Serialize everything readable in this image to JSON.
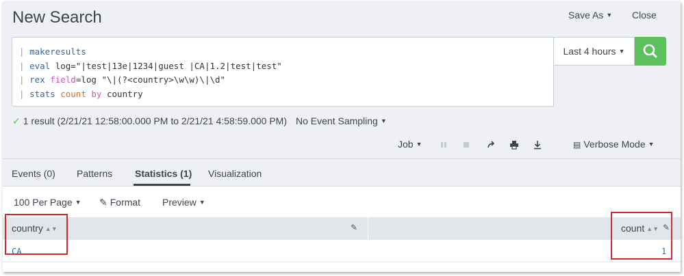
{
  "header": {
    "title": "New Search",
    "save_as_label": "Save As",
    "close_label": "Close"
  },
  "query": {
    "lines": [
      {
        "pipe": "|",
        "cmd": "makeresults"
      },
      {
        "pipe": "|",
        "cmd": "eval",
        "rest": " log=\"|test|13e|1234|guest |CA|1.2|test|test\""
      },
      {
        "pipe": "|",
        "cmd": "rex",
        "kw": "field",
        "rest": "=log \"\\|(?<country>\\w\\w)\\|\\d\""
      },
      {
        "pipe": "|",
        "cmd": "stats",
        "fn": "count",
        "kw2": "by",
        "rest": " country"
      }
    ]
  },
  "time_picker": {
    "label": "Last 4 hours"
  },
  "status": {
    "result_text": "1 result (2/21/21 12:58:00.000 PM to 2/21/21 4:58:59.000 PM)",
    "sampling_label": "No Event Sampling"
  },
  "job": {
    "job_label": "Job",
    "mode_label": "Verbose Mode"
  },
  "tabs": [
    {
      "label": "Events (0)",
      "active": false
    },
    {
      "label": "Patterns",
      "active": false
    },
    {
      "label": "Statistics (1)",
      "active": true
    },
    {
      "label": "Visualization",
      "active": false
    }
  ],
  "results_toolbar": {
    "per_page_label": "100 Per Page",
    "format_label": "Format",
    "preview_label": "Preview"
  },
  "table": {
    "columns": [
      "country",
      "count"
    ],
    "rows": [
      [
        "CA",
        "1"
      ]
    ]
  },
  "colors": {
    "search_button": "#5cc05c",
    "highlight": "#d9272e",
    "link": "#1e6fb7"
  }
}
